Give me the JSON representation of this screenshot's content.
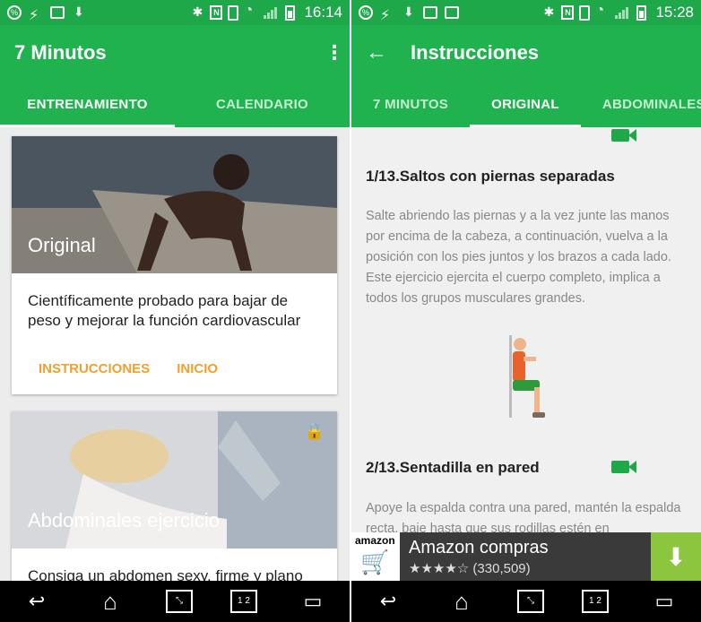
{
  "left": {
    "status": {
      "time": "16:14"
    },
    "appbar": {
      "title": "7 Minutos"
    },
    "tabs": [
      {
        "label": "ENTRENAMIENTO",
        "active": true
      },
      {
        "label": "CALENDARIO",
        "active": false
      }
    ],
    "cards": [
      {
        "title": "Original",
        "description": "Científicamente probado para bajar de peso y mejorar la función cardiovascular",
        "actions": [
          "INSTRUCCIONES",
          "INICIO"
        ]
      },
      {
        "title": "Abdominales ejercicio",
        "description": "Consiga un abdomen sexy, firme y plano",
        "locked": true
      }
    ]
  },
  "right": {
    "status": {
      "time": "15:28"
    },
    "appbar": {
      "title": "Instrucciones"
    },
    "tabs": [
      {
        "label": "7 MINUTOS",
        "active": false
      },
      {
        "label": "ORIGINAL",
        "active": true
      },
      {
        "label": "ABDOMINALES",
        "active": false
      }
    ],
    "exercises": [
      {
        "title": "1/13.Saltos con piernas separadas",
        "text": "Salte abriendo las piernas y a la vez junte las manos por encima de la cabeza, a continuación, vuelva a la posición con los pies juntos y los brazos a cada lado. Este ejercicio ejercita el cuerpo completo, implica a todos los grupos musculares grandes."
      },
      {
        "title": "2/13.Sentadilla en pared",
        "text": "Apoye la espalda contra una pared, mantén la espalda recta, baje hasta que sus rodillas estén en"
      }
    ],
    "ad": {
      "brand": "amazon",
      "name": "Amazon compras",
      "stars": "★★★★☆",
      "reviews": "(330,509)"
    }
  },
  "colors": {
    "primary": "#1fb24f",
    "status": "#1fa84a",
    "accent": "#f0a030",
    "ad_download": "#8cc63e"
  },
  "icons": [
    "percent-icon",
    "usb-icon",
    "image-icon",
    "download-icon",
    "bluetooth-icon",
    "nfc-icon",
    "vibrate-icon",
    "wifi-icon",
    "signal-icon",
    "battery-icon",
    "back-arrow-icon",
    "more-vert-icon",
    "lock-icon",
    "video-icon",
    "home-icon",
    "recents-icon"
  ]
}
